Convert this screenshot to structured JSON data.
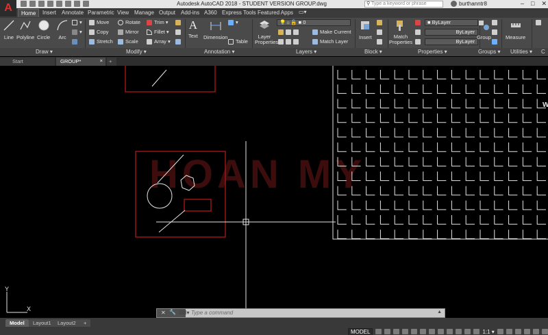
{
  "title_bar": {
    "app_logo": "A",
    "title": "Autodesk AutoCAD 2018 - STUDENT VERSION     GROUP.dwg",
    "search_placeholder": "Type a keyword or phrase",
    "user_name": "burthanntr8",
    "window_controls": [
      "–",
      "□",
      "✕"
    ]
  },
  "ribbon_tabs": [
    "Home",
    "Insert",
    "Annotate",
    "Parametric",
    "View",
    "Manage",
    "Output",
    "Add-ins",
    "A360",
    "Express Tools",
    "Featured Apps"
  ],
  "active_tab": "Home",
  "panels": {
    "draw": {
      "label": "Draw ▾",
      "tools": [
        "Line",
        "Polyline",
        "Circle",
        "Arc"
      ]
    },
    "modify": {
      "label": "Modify ▾",
      "tools": [
        "Move",
        "Rotate",
        "Trim ▾",
        "Copy",
        "Mirror",
        "Fillet ▾",
        "Stretch",
        "Scale",
        "Array ▾"
      ]
    },
    "annotation": {
      "label": "Annotation ▾",
      "tools": [
        "Text",
        "Dimension",
        "Table"
      ]
    },
    "layers": {
      "label": "Layers ▾",
      "tools": [
        "Layer Properties",
        "Make Current",
        "Match Layer"
      ],
      "current_layer": "0"
    },
    "block": {
      "label": "Block ▾",
      "tools": [
        "Insert"
      ]
    },
    "properties": {
      "label": "Properties ▾",
      "tools": [
        "Match Properties"
      ],
      "color": "ByLayer",
      "linetype": "ByLayer",
      "lineweight": "ByLayer"
    },
    "groups": {
      "label": "Groups ▾",
      "tools": [
        "Group"
      ]
    },
    "utilities": {
      "label": "Utilities ▾",
      "tools": [
        "Measure"
      ]
    },
    "clipboard": {
      "label": "C"
    }
  },
  "file_tabs": {
    "start": "Start",
    "current": "GROUP*",
    "close": "×",
    "new": "+"
  },
  "canvas": {
    "watermark": "HOAN MY",
    "ucs_y": "Y",
    "ucs_x": "X",
    "edge_letter": "W",
    "colors": {
      "background": "#000000",
      "red_lines": "#b01818",
      "white_lines": "#e6e6e6",
      "watermark": "#3d0d0d"
    }
  },
  "command_line": {
    "placeholder": "Type  a  command",
    "close": "✕",
    "settings": "🔧",
    "prompt": "⌨▾"
  },
  "layout_tabs": [
    "Model",
    "Layout1",
    "Layout2",
    "+"
  ],
  "status_bar": {
    "model": "MODEL",
    "scale": "1:1 ▾"
  }
}
